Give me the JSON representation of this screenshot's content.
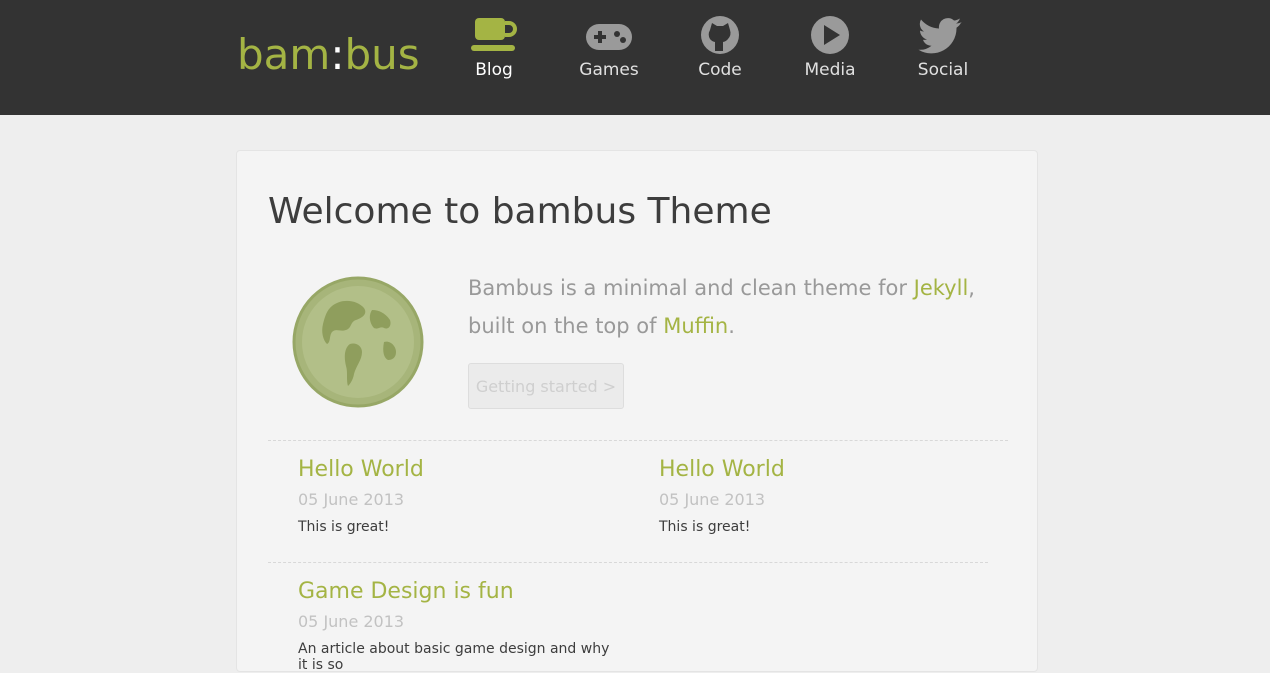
{
  "header": {
    "logo_left": "bam",
    "logo_colon": ":",
    "logo_right": "bus",
    "nav": [
      {
        "label": "Blog",
        "icon": "coffee-cup-icon"
      },
      {
        "label": "Games",
        "icon": "gamepad-icon"
      },
      {
        "label": "Code",
        "icon": "github-icon"
      },
      {
        "label": "Media",
        "icon": "play-icon"
      },
      {
        "label": "Social",
        "icon": "twitter-icon"
      }
    ]
  },
  "main": {
    "title": "Welcome to bambus Theme",
    "intro": {
      "text1": "Bambus is a minimal and clean theme for ",
      "link1": "Jekyll",
      "text2": ", built on the top of ",
      "link2": "Muffin",
      "text3": "."
    },
    "cta_label": "Getting started >",
    "posts": [
      {
        "title": "Hello World",
        "date": "05 June 2013",
        "excerpt": "This is great!"
      },
      {
        "title": "Hello World",
        "date": "05 June 2013",
        "excerpt": "This is great!"
      },
      {
        "title": "Game Design is fun",
        "date": "05 June 2013",
        "excerpt": "An article about basic game design and why it is so"
      }
    ]
  },
  "colors": {
    "accent": "#a4b444",
    "header_bg": "#333333",
    "page_bg": "#eeeeee",
    "card_bg": "#f4f4f4"
  }
}
